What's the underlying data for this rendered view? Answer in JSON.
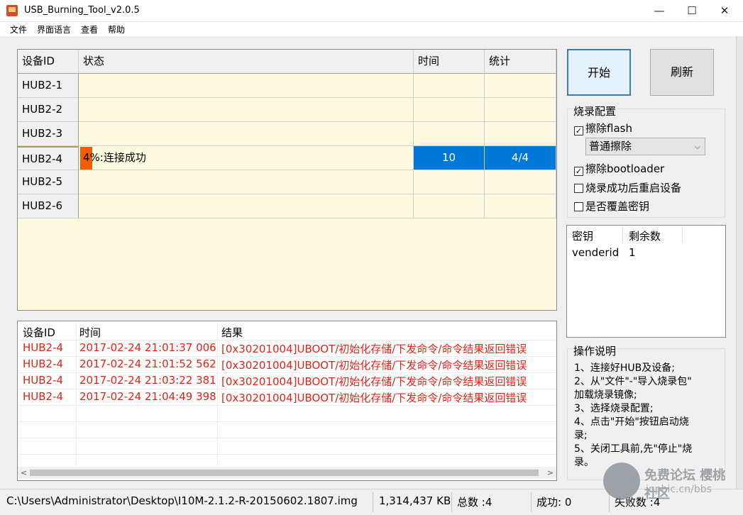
{
  "window": {
    "title": "USB_Burning_Tool_v2.0.5",
    "controls": {
      "minimize": "—",
      "maximize": "☐",
      "close": "✕"
    }
  },
  "menu": [
    "文件",
    "界面语言",
    "查看",
    "帮助"
  ],
  "device_grid": {
    "headers": [
      "设备ID",
      "状态",
      "时间",
      "统计"
    ],
    "rows": [
      {
        "id": "HUB2-1",
        "status": "",
        "time": "",
        "count": ""
      },
      {
        "id": "HUB2-2",
        "status": "",
        "time": "",
        "count": ""
      },
      {
        "id": "HUB2-3",
        "status": "",
        "time": "",
        "count": ""
      },
      {
        "id": "HUB2-4",
        "status": "4%:连接成功",
        "time": "10",
        "count": "4/4",
        "progress": 0.04,
        "selected": true
      },
      {
        "id": "HUB2-5",
        "status": "",
        "time": "",
        "count": ""
      },
      {
        "id": "HUB2-6",
        "status": "",
        "time": "",
        "count": ""
      }
    ],
    "colors": {
      "background": "#fdfae0",
      "progress": "#f25c05",
      "selection": "#0078d7"
    }
  },
  "buttons": {
    "start": "开始",
    "refresh": "刷新"
  },
  "burn_config": {
    "title": "烧录配置",
    "erase_flash": {
      "label": "擦除flash",
      "checked": true
    },
    "erase_mode": "普通擦除",
    "erase_bootloader": {
      "label": "擦除bootloader",
      "checked": true
    },
    "reboot_after": {
      "label": "烧录成功后重启设备",
      "checked": false
    },
    "overwrite_key": {
      "label": "是否覆盖密钥",
      "checked": false
    }
  },
  "key_table": {
    "headers": [
      "密钥",
      "剩余数"
    ],
    "rows": [
      {
        "key": "venderid",
        "remaining": "1"
      }
    ]
  },
  "instructions": {
    "title": "操作说明",
    "lines": [
      "1、连接好HUB及设备;",
      "2、从\"文件\"-\"导入烧录包\"",
      "加载烧录镜像;",
      "3、选择烧录配置;",
      "4、点击\"开始\"按钮启动烧",
      "录;",
      "5、关闭工具前,先\"停止\"烧",
      "录。"
    ]
  },
  "log": {
    "headers": [
      "设备ID",
      "时间",
      "结果"
    ],
    "rows": [
      {
        "id": "HUB2-4",
        "time": "2017-02-24 21:01:37 006",
        "result": "[0x30201004]UBOOT/初始化存储/下发命令/命令结果返回错误"
      },
      {
        "id": "HUB2-4",
        "time": "2017-02-24 21:01:52 562",
        "result": "[0x30201004]UBOOT/初始化存储/下发命令/命令结果返回错误"
      },
      {
        "id": "HUB2-4",
        "time": "2017-02-24 21:03:22 381",
        "result": "[0x30201004]UBOOT/初始化存储/下发命令/命令结果返回错误"
      },
      {
        "id": "HUB2-4",
        "time": "2017-02-24 21:04:49 398",
        "result": "[0x30201004]UBOOT/初始化存储/下发命令/命令结果返回错误"
      }
    ],
    "error_color": "#e22318"
  },
  "status_bar": {
    "path": "C:\\Users\\Administrator\\Desktop\\I10M-2.1.2-R-20150602.1807.img",
    "size": "1,314,437 KB",
    "total": "总数 :4",
    "success": "成功:  0",
    "failed": "失败数 :4"
  },
  "watermark": {
    "text": "免费论坛 樱桃社区",
    "url": "inphic.cn/bbs"
  }
}
